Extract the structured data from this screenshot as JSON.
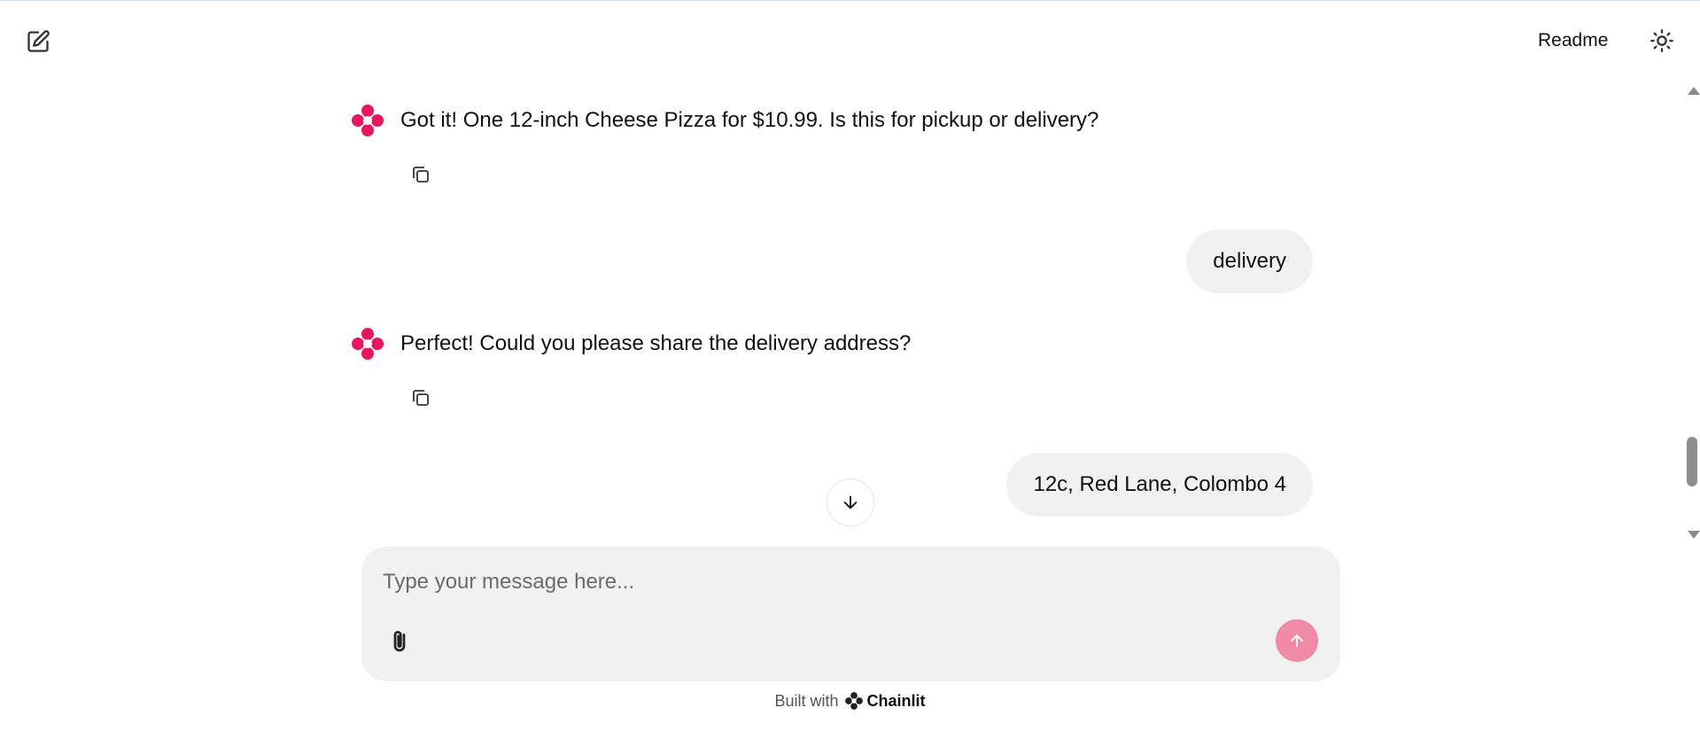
{
  "header": {
    "new_chat_icon": "edit-icon",
    "readme_label": "Readme",
    "theme_icon": "sun-icon"
  },
  "messages": [
    {
      "role": "assistant",
      "text": "Got it! One 12-inch Cheese Pizza for $10.99. Is this for pickup or delivery?"
    },
    {
      "role": "user",
      "text": "delivery"
    },
    {
      "role": "assistant",
      "text": "Perfect! Could you please share the delivery address?"
    },
    {
      "role": "user",
      "text": "12c, Red Lane, Colombo 4"
    }
  ],
  "composer": {
    "placeholder": "Type your message here...",
    "value": ""
  },
  "footer": {
    "prefix": "Built with",
    "brand": "Chainlit"
  },
  "colors": {
    "accent": "#e8175d",
    "send_button": "#f18aa7",
    "bubble": "#f1f1f1"
  }
}
